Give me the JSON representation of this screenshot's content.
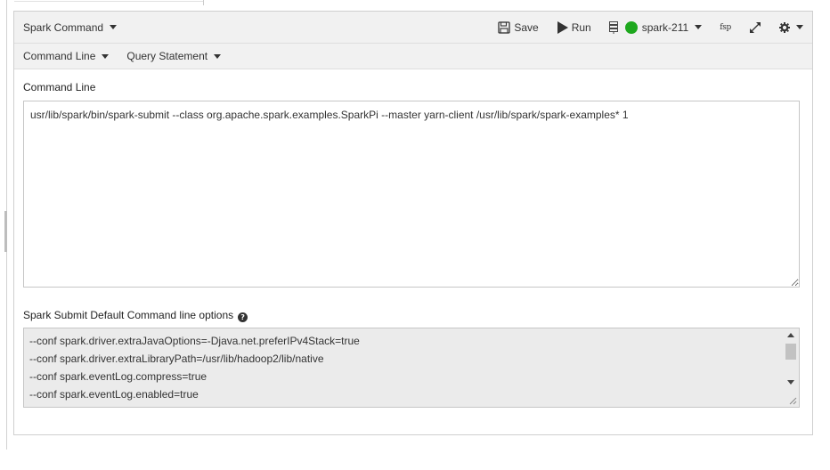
{
  "header": {
    "command_type": "Spark Command",
    "save_label": "Save",
    "run_label": "Run",
    "cluster_name": "spark-211",
    "fsp_label": "fsp",
    "status_color": "#1ea81e"
  },
  "subheader": {
    "command_line_tab": "Command Line",
    "query_statement_tab": "Query Statement"
  },
  "command_section": {
    "label": "Command Line",
    "value": "usr/lib/spark/bin/spark-submit --class org.apache.spark.examples.SparkPi --master yarn-client /usr/lib/spark/spark-examples* 1"
  },
  "defaults_section": {
    "label": "Spark Submit Default Command line options",
    "options": [
      "--conf spark.driver.extraJavaOptions=-Djava.net.preferIPv4Stack=true",
      "--conf spark.driver.extraLibraryPath=/usr/lib/hadoop2/lib/native",
      "--conf spark.eventLog.compress=true",
      "--conf spark.eventLog.enabled=true"
    ]
  },
  "icons": [
    "save-icon",
    "play-icon",
    "cluster-icon",
    "expand-icon",
    "gear-icon",
    "help-icon"
  ]
}
